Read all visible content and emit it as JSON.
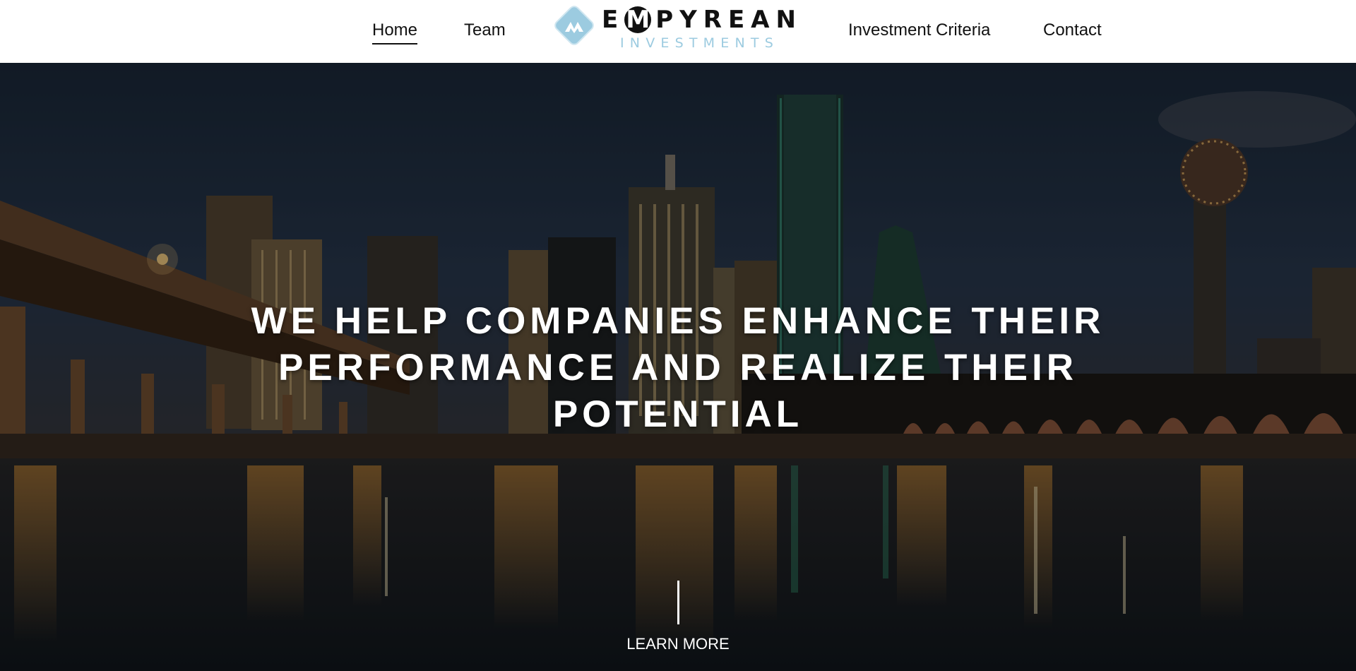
{
  "nav": {
    "items": [
      {
        "label": "Home",
        "active": true
      },
      {
        "label": "Team",
        "active": false
      },
      {
        "label": "Investment Criteria",
        "active": false
      },
      {
        "label": "Contact",
        "active": false
      }
    ]
  },
  "logo": {
    "word_first": "E",
    "word_circled": "M",
    "word_rest": "PYREAN",
    "sub": "INVESTMENTS",
    "mark_icon": "empyrean-diamond-logo",
    "accent_color": "#9ccbe0"
  },
  "hero": {
    "background": "dallas-skyline-night-photo",
    "heading_lines": [
      "WE HELP COMPANIES ENHANCE THEIR",
      "PERFORMANCE AND REALIZE THEIR",
      "POTENTIAL"
    ],
    "cta_label": "LEARN MORE"
  }
}
